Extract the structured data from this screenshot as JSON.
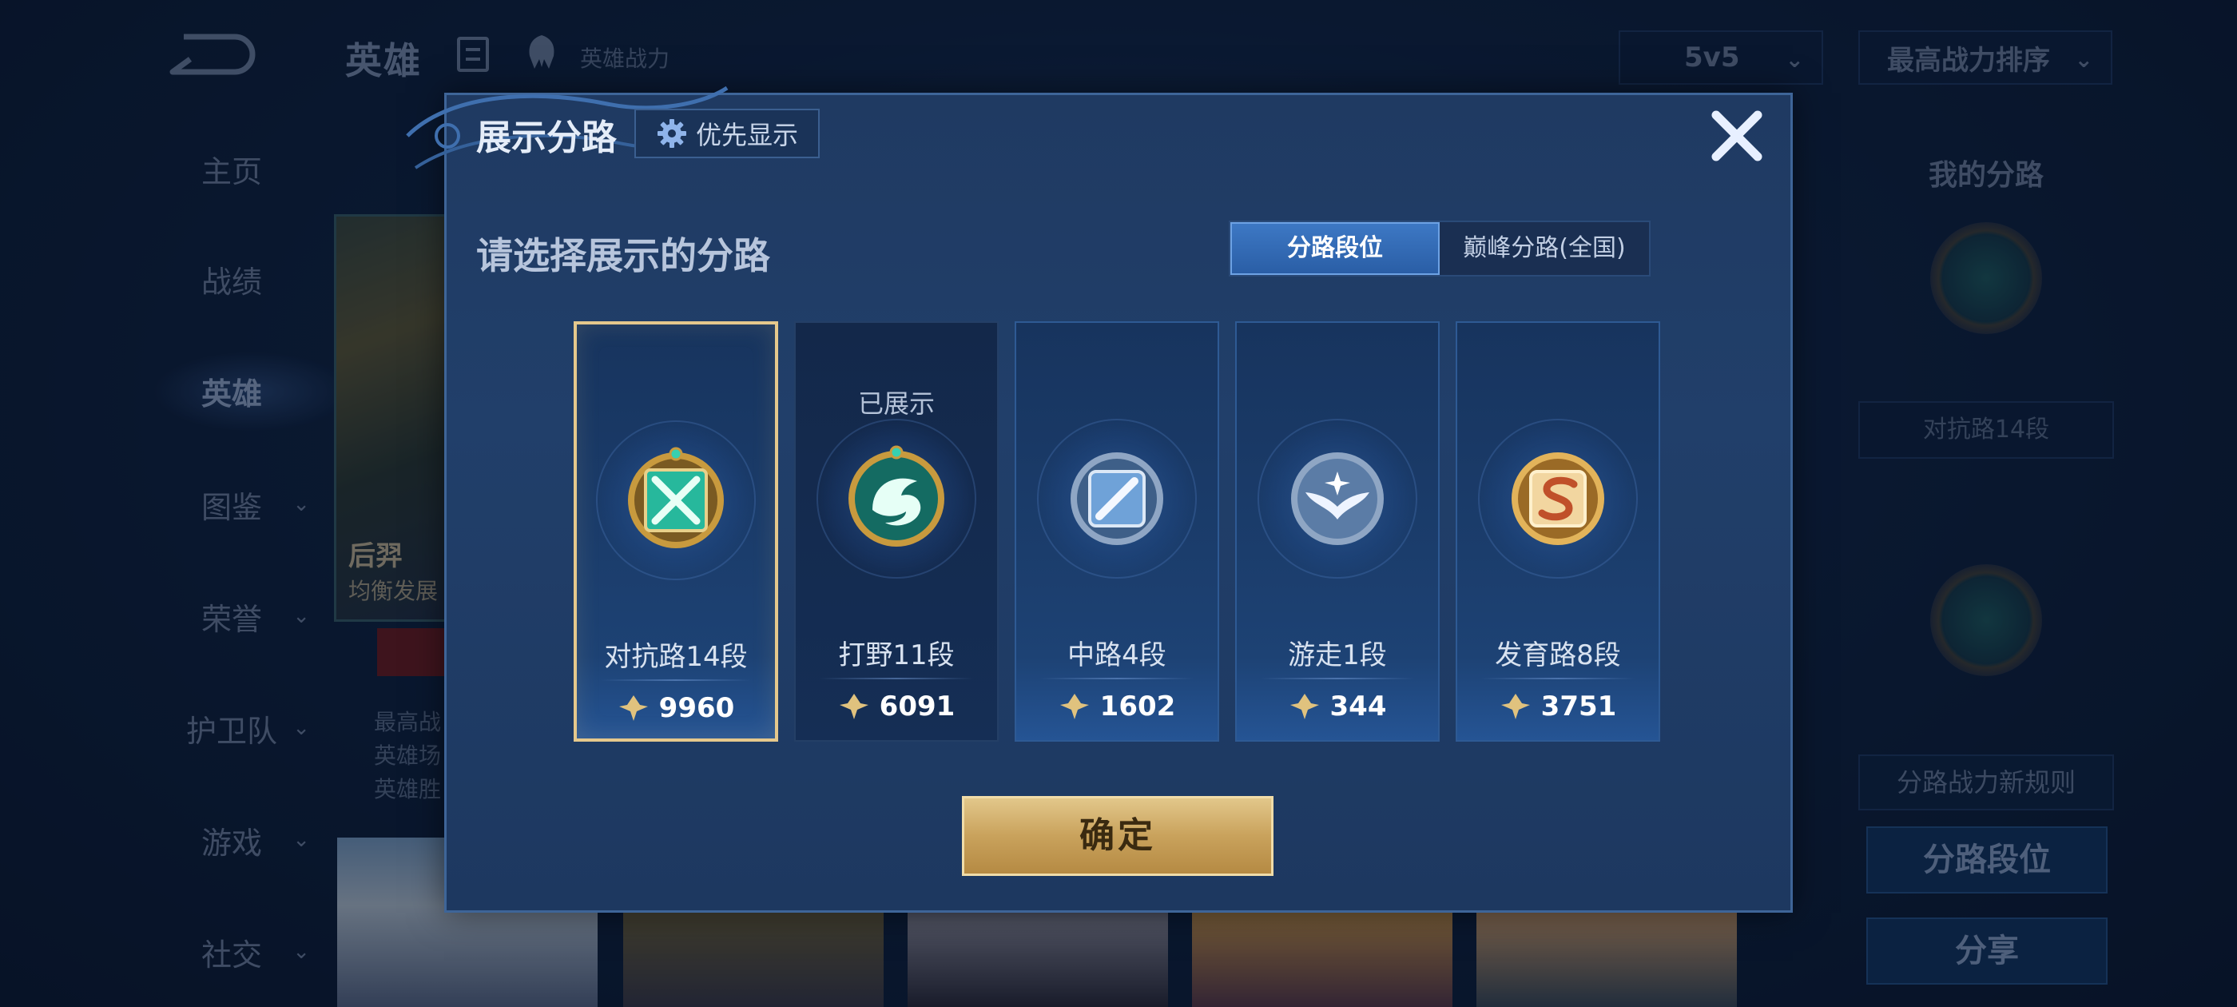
{
  "background": {
    "topbar": {
      "title": "英雄",
      "power_label": "英雄战力",
      "mode_value": "5v5",
      "sort_value": "最高战力排序"
    },
    "nav": [
      {
        "label": "主页"
      },
      {
        "label": "战绩"
      },
      {
        "label": "英雄"
      },
      {
        "label": "图鉴"
      },
      {
        "label": "荣誉"
      },
      {
        "label": "护卫队"
      },
      {
        "label": "游戏"
      },
      {
        "label": "社交"
      }
    ],
    "hero_card": {
      "name": "后羿",
      "role": "均衡发展",
      "stats": [
        "最高战",
        "英雄场",
        "英雄胜"
      ]
    },
    "right_panel": {
      "title": "我的分路",
      "badge_label": "对抗路14段",
      "rule_label": "分路战力新规则",
      "lane_rank_button": "分路段位",
      "share_button": "分享"
    }
  },
  "modal": {
    "title": "展示分路",
    "priority_button": "优先显示",
    "subtitle": "请选择展示的分路",
    "segment": {
      "active": "分路段位",
      "inactive": "巅峰分路(全国)"
    },
    "lanes": [
      {
        "name": "对抗路14段",
        "score": "9960",
        "selected": true,
        "shown_label": ""
      },
      {
        "name": "打野11段",
        "score": "6091",
        "selected": false,
        "shown_label": "已展示"
      },
      {
        "name": "中路4段",
        "score": "1602",
        "selected": false,
        "shown_label": ""
      },
      {
        "name": "游走1段",
        "score": "344",
        "selected": false,
        "shown_label": ""
      },
      {
        "name": "发育路8段",
        "score": "3751",
        "selected": false,
        "shown_label": ""
      }
    ],
    "confirm_button": "确定"
  },
  "colors": {
    "gold_accent": "#e5c88c",
    "active_tab": "#3d78c4",
    "modal_bg": "#213f6a"
  }
}
